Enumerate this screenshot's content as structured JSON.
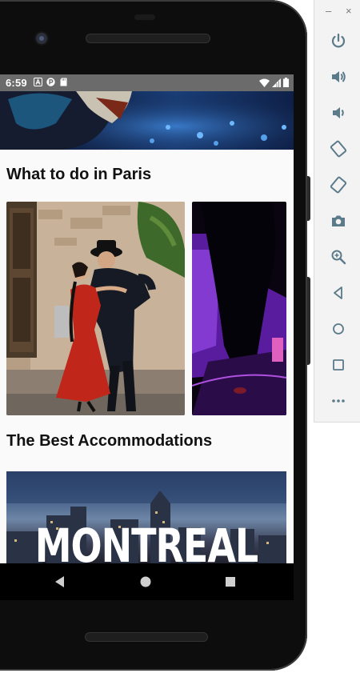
{
  "status_bar": {
    "time": "6:59",
    "left_icons": [
      "a-icon",
      "p-icon",
      "sd-card-icon"
    ],
    "right_icons": [
      "wifi-icon",
      "signal-icon",
      "battery-icon"
    ]
  },
  "sections": {
    "what_to_do_title": "What to do in Paris",
    "accommodations_title": "The Best Accommodations"
  },
  "accommodation_card": {
    "city_label": "MONTREAL"
  },
  "nav_bar": {
    "buttons": [
      "back-icon",
      "home-icon",
      "recents-icon"
    ]
  },
  "emulator_controls": {
    "window_min": "–",
    "window_close": "×",
    "buttons": [
      "power-icon",
      "volume-up-icon",
      "volume-down-icon",
      "rotate-left-icon",
      "rotate-right-icon",
      "camera-icon",
      "zoom-icon",
      "back-icon",
      "home-icon",
      "overview-icon",
      "more-icon"
    ]
  },
  "colors": {
    "status_bar": "#6b6b6b",
    "screen_bg": "#fafafa",
    "emulator_icon": "#5b7a8a"
  }
}
